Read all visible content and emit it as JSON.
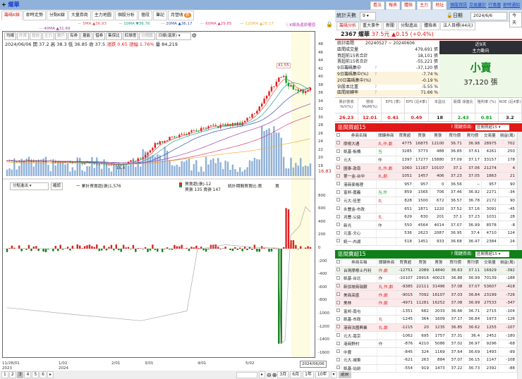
{
  "left": {
    "title": "燿華",
    "plus": "+",
    "tabs": [
      "籌碼K線",
      "即時走勢",
      "分點K線",
      "大量券商",
      "主力地圖",
      "個股分析",
      "億段",
      "筆記",
      "月營收"
    ],
    "tab_badge": "新",
    "ma": [
      {
        "label": "5MA",
        "val": "▲36.93",
        "color": "#e05050"
      },
      {
        "label": "10MA",
        "val": "▼36.76",
        "color": "#20a090"
      },
      {
        "label": "20MA",
        "val": "▲36.17",
        "color": "#3050b0"
      },
      {
        "label": "60MA",
        "val": "▲29.85",
        "color": "#e04070"
      },
      {
        "label": "120MA",
        "val": "▲25.17",
        "color": "#f0b040"
      },
      {
        "label": "40MA",
        "val": "▲31.69",
        "color": "#a040a0"
      }
    ],
    "ma_note": "ⓘK線為還原權值",
    "toolbar": [
      {
        "t": "均線",
        "d": false
      },
      {
        "t": "外資",
        "d": true
      },
      {
        "t": "投信",
        "d": true
      },
      {
        "t": "主力",
        "d": true
      },
      {
        "t": "散戶",
        "d": true
      },
      {
        "t": "有券",
        "d": false
      },
      {
        "t": "量能",
        "d": false
      },
      {
        "t": "借券",
        "d": false
      },
      {
        "t": "集保比",
        "d": false
      },
      {
        "t": "紅綠燈",
        "d": false
      },
      {
        "t": "分價圖",
        "d": true
      }
    ],
    "period": "日線(還原)",
    "ohlc": {
      "date": "2024/06/06",
      "open": "開 37.2",
      "high": "高 38.3",
      "low": "低 36.85",
      "close": "收 37.5",
      "chg": "漲跌 0.65",
      "pct": "漲幅 1.76%",
      "vol": "量 84,219"
    },
    "peak_label": "41.55",
    "low_label": "18.4",
    "last_label": "16.83",
    "price_ticks": [
      "48",
      "46",
      "44",
      "42",
      "40",
      "38",
      "36",
      "34",
      "32",
      "30",
      "28",
      "26",
      "24",
      "22",
      "20",
      "18"
    ],
    "lower": {
      "select": "分點進出",
      "confirm": "確認",
      "cum": "一 累計買賣超(張)1,576",
      "net": "買賣超(張)-12",
      "bs": "買張 135 賣張 147",
      "ratio": "統計期間買賣比:賣",
      "sell": "賣",
      "ticks": [
        "800",
        "600",
        "400",
        "200",
        "0",
        "-200",
        "-400",
        "-600",
        "-800",
        "-1000",
        "-1200",
        "-1400",
        "-1600"
      ]
    },
    "dates": [
      "11/28/01",
      "2023",
      "1/02",
      "2024",
      "2/01",
      "3/01",
      "4/01",
      "5/02"
    ],
    "cursor_date": "2024/06/06",
    "pages": [
      "1",
      "2",
      "3",
      "4",
      "5",
      "6",
      "▸"
    ],
    "ranges": [
      "3月",
      "6月",
      "1年",
      "10年"
    ],
    "reset": "還原"
  },
  "right": {
    "buttons": [
      "看法",
      "報表",
      "體檢",
      "主力",
      "地址"
    ],
    "links": [
      "個股資訊",
      "交易彙計",
      "行事曆",
      "即時通知"
    ],
    "days_label": "統計天數",
    "days": "9",
    "date_label": "日期",
    "date": "2024/6/6",
    "today": "今天",
    "tabs": [
      "籌碼分析",
      "重大事件",
      "新聞",
      "分點進出",
      "體檢表",
      "法人目標(44元)"
    ],
    "stock": {
      "code": "2367 燿華",
      "price": "37.5元",
      "chg": "▲0.15 (+0.4%)"
    },
    "stats": [
      {
        "k": "統計區間",
        "v": "20240527 ~ 20240606"
      },
      {
        "k": "區間成交量",
        "v": "479,691 張"
      },
      {
        "k": "買超前15名合計",
        "v": "18,101 張"
      },
      {
        "k": "賣超前15名合計",
        "v": "-55,221 張"
      },
      {
        "k": "9日籌碼集中",
        "q": "?",
        "v": "-37,120 張"
      },
      {
        "k": "9日籌碼集中(%)",
        "q": "?",
        "v": "-7.74 %",
        "y": true
      },
      {
        "k": "20日籌碼集中(%)",
        "v": "-0.19 %",
        "y": true
      },
      {
        "k": "佔股本比重",
        "q": "?",
        "v": "-5.55 %"
      },
      {
        "k": "區間周轉率",
        "q": "?",
        "v": "71.66 %",
        "y": true
      }
    ],
    "main": {
      "h1": "近9天",
      "h2": "主力動向",
      "verdict": "小賣",
      "amount": "37,120 張"
    },
    "fin": [
      {
        "h": "累計營收 YoY(%)",
        "v": "26.23",
        "c": "#e02020"
      },
      {
        "h": "營收 MoM(%)",
        "v": "12.01",
        "c": "#e02020"
      },
      {
        "h": "EPS (季)",
        "v": "0.41",
        "c": "#e02020"
      },
      {
        "h": "EPS (近4季)",
        "v": "0.49",
        "c": "#e02020"
      },
      {
        "h": "本益比",
        "v": "18",
        "c": "#222"
      },
      {
        "h": "股價 淨值比",
        "v": "2.43",
        "c": "#10a020"
      },
      {
        "h": "殖利率 (%)",
        "v": "0.81",
        "c": "#10a020"
      },
      {
        "h": "ROE (近4季)",
        "v": "3.2",
        "c": "#222"
      }
    ],
    "cols": [
      "券商名稱",
      "關鍵券商",
      "買賣超",
      "買張",
      "賣張",
      "買均價",
      "賣均價",
      "交易量",
      "損益(萬)"
    ],
    "key_label": "? 關鍵券商:",
    "buy": {
      "title": "區間買超15",
      "select": "區間買超15",
      "rows": [
        [
          "摩根大通",
          "丸,作,劇",
          "4775",
          "16875",
          "12100",
          "36.71",
          "36.98",
          "28975",
          "702",
          "p"
        ],
        [
          "凱基-板橋",
          "当",
          "3285",
          "3773",
          "488",
          "36.85",
          "37.61",
          "4261",
          "250",
          ""
        ],
        [
          "元大",
          "作",
          "1397",
          "17277",
          "15880",
          "37.09",
          "37.17",
          "33157",
          "178",
          ""
        ],
        [
          "國泰-敦南",
          "丸,作,劇",
          "1060",
          "11167",
          "10107",
          "37.1",
          "37.06",
          "21274",
          "4",
          "p"
        ],
        [
          "第一金-台中",
          "丸,劇",
          "1051",
          "1457",
          "406",
          "37.23",
          "37.05",
          "1863",
          "21",
          "p"
        ],
        [
          "港商麥格理",
          "",
          "957",
          "957",
          "0",
          "36.56",
          "--",
          "957",
          "90",
          ""
        ],
        [
          "富邦-嘉義",
          "当,作",
          "859",
          "1565",
          "706",
          "37.46",
          "36.92",
          "2271",
          "-34",
          ""
        ],
        [
          "元大-佳里",
          "丸",
          "828",
          "1500",
          "672",
          "36.57",
          "36.78",
          "2172",
          "90",
          ""
        ],
        [
          "永豐金-市政",
          "",
          "651",
          "1871",
          "1220",
          "37.52",
          "37.16",
          "3091",
          "-45",
          ""
        ],
        [
          "兆豐-公益",
          "丸",
          "629",
          "830",
          "201",
          "37.1",
          "37.23",
          "1031",
          "28",
          ""
        ],
        [
          "新光",
          "作",
          "550",
          "4564",
          "4014",
          "37.07",
          "36.99",
          "8578",
          "-8",
          ""
        ],
        [
          "元富-文心",
          "",
          "536",
          "2623",
          "2087",
          "36.95",
          "37.4",
          "4710",
          "124",
          ""
        ],
        [
          "統一-內湖",
          "",
          "518",
          "1451",
          "933",
          "36.68",
          "36.47",
          "2384",
          "24",
          ""
        ]
      ]
    },
    "sell": {
      "title": "區間賣超15",
      "select": "區間賣超15",
      "rows": [
        [
          "台灣摩根士丹利",
          "作,劇",
          "-12751",
          "2089",
          "14840",
          "36.63",
          "37.11",
          "16929",
          "-392",
          "g"
        ],
        [
          "凱基-台北",
          "作",
          "-10107",
          "29916",
          "40023",
          "36.88",
          "36.99",
          "70139",
          "-188",
          ""
        ],
        [
          "新加坡商瑞銀",
          "丸,作,劇",
          "-9385",
          "22111",
          "31496",
          "37.08",
          "37.07",
          "53607",
          "-418",
          "p"
        ],
        [
          "美商高盛",
          "作,劇",
          "-9015",
          "7092",
          "16107",
          "37.03",
          "36.84",
          "23199",
          "-726",
          "p"
        ],
        [
          "美林",
          "作,劇",
          "-4971",
          "11281",
          "16252",
          "37.08",
          "36.99",
          "27533",
          "-347",
          "p"
        ],
        [
          "富邦-南屯",
          "",
          "-1351",
          "682",
          "2033",
          "36.66",
          "36.71",
          "2715",
          "-104",
          ""
        ],
        [
          "凱基-市政",
          "丸",
          "-1245",
          "364",
          "1609",
          "37.17",
          "36.84",
          "1973",
          "-126",
          ""
        ],
        [
          "港商法國興業",
          "丸,劇",
          "-1215",
          "20",
          "1235",
          "36.85",
          "36.62",
          "1255",
          "-107",
          "p"
        ],
        [
          "元大-南京",
          "",
          "-1062",
          "695",
          "1757",
          "37.31",
          "36.4",
          "2452",
          "-180",
          ""
        ],
        [
          "港商野村",
          "作",
          "-876",
          "4210",
          "5086",
          "37.02",
          "36.97",
          "9296",
          "-68",
          ""
        ],
        [
          "中農",
          "",
          "-845",
          "324",
          "1169",
          "37.64",
          "36.69",
          "1493",
          "-99",
          ""
        ],
        [
          "元大-城東",
          "",
          "-621",
          "263",
          "884",
          "37.07",
          "36.15",
          "1147",
          "-108",
          ""
        ],
        [
          "凱基-站前",
          "",
          "-554",
          "919",
          "1473",
          "37.22",
          "36.73",
          "2392",
          "-88",
          ""
        ]
      ]
    }
  }
}
